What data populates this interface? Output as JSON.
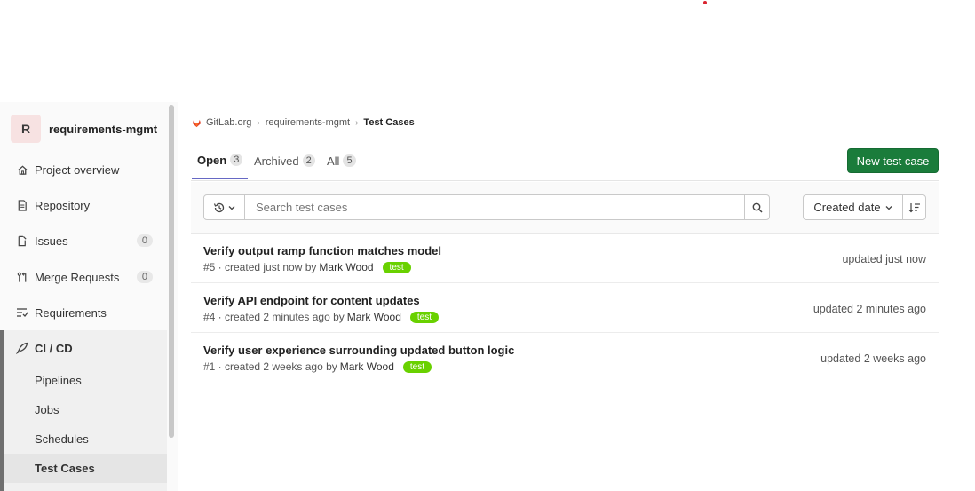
{
  "project": {
    "avatar_letter": "R",
    "name": "requirements-mgmt"
  },
  "sidebar": {
    "items": [
      {
        "label": "Project overview",
        "icon": "home-icon"
      },
      {
        "label": "Repository",
        "icon": "document-icon"
      },
      {
        "label": "Issues",
        "icon": "issues-icon",
        "count": "0"
      },
      {
        "label": "Merge Requests",
        "icon": "merge-request-icon",
        "count": "0"
      },
      {
        "label": "Requirements",
        "icon": "requirements-icon"
      }
    ],
    "cicd": {
      "label": "CI / CD",
      "icon": "rocket-icon",
      "subitems": [
        "Pipelines",
        "Jobs",
        "Schedules",
        "Test Cases"
      ],
      "active": "Test Cases"
    }
  },
  "breadcrumb": {
    "root": "GitLab.org",
    "project": "requirements-mgmt",
    "current": "Test Cases"
  },
  "tabs": [
    {
      "label": "Open",
      "count": "3",
      "active": true
    },
    {
      "label": "Archived",
      "count": "2",
      "active": false
    },
    {
      "label": "All",
      "count": "5",
      "active": false
    }
  ],
  "new_button": "New test case",
  "search": {
    "placeholder": "Search test cases"
  },
  "sort": {
    "label": "Created date"
  },
  "test_cases": [
    {
      "title": "Verify output ramp function matches model",
      "meta": "#5 · created just now by",
      "author": "Mark Wood",
      "label": "test",
      "updated": "updated just now"
    },
    {
      "title": "Verify API endpoint for content updates",
      "meta": "#4 · created 2 minutes ago by",
      "author": "Mark Wood",
      "label": "test",
      "updated": "updated 2 minutes ago"
    },
    {
      "title": "Verify user experience surrounding updated button logic",
      "meta": "#1 · created 2 weeks ago by",
      "author": "Mark Wood",
      "label": "test",
      "updated": "updated 2 weeks ago"
    }
  ],
  "colors": {
    "primary_button": "#1a7c3b",
    "label_green": "#69d100",
    "active_tab": "#6668c4"
  }
}
